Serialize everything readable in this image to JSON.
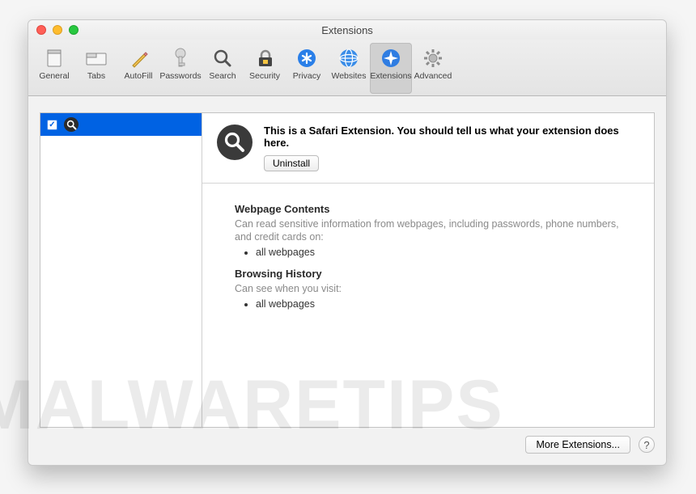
{
  "window": {
    "title": "Extensions"
  },
  "toolbar": [
    {
      "id": "general",
      "label": "General"
    },
    {
      "id": "tabs",
      "label": "Tabs"
    },
    {
      "id": "autofill",
      "label": "AutoFill"
    },
    {
      "id": "passwords",
      "label": "Passwords"
    },
    {
      "id": "search",
      "label": "Search"
    },
    {
      "id": "security",
      "label": "Security"
    },
    {
      "id": "privacy",
      "label": "Privacy"
    },
    {
      "id": "websites",
      "label": "Websites"
    },
    {
      "id": "extensions",
      "label": "Extensions"
    },
    {
      "id": "advanced",
      "label": "Advanced"
    }
  ],
  "selected_tab": "extensions",
  "sidebar": {
    "items": [
      {
        "checked": true,
        "icon": "search-icon"
      }
    ]
  },
  "detail": {
    "description": "This is a Safari Extension. You should tell us what your extension does here.",
    "uninstall_label": "Uninstall",
    "sections": [
      {
        "title": "Webpage Contents",
        "text": "Can read sensitive information from webpages, including passwords, phone numbers, and credit cards on:",
        "items": [
          "all webpages"
        ]
      },
      {
        "title": "Browsing History",
        "text": "Can see when you visit:",
        "items": [
          "all webpages"
        ]
      }
    ]
  },
  "footer": {
    "more_label": "More Extensions...",
    "help_label": "?"
  },
  "watermark": "MALWARETIPS"
}
